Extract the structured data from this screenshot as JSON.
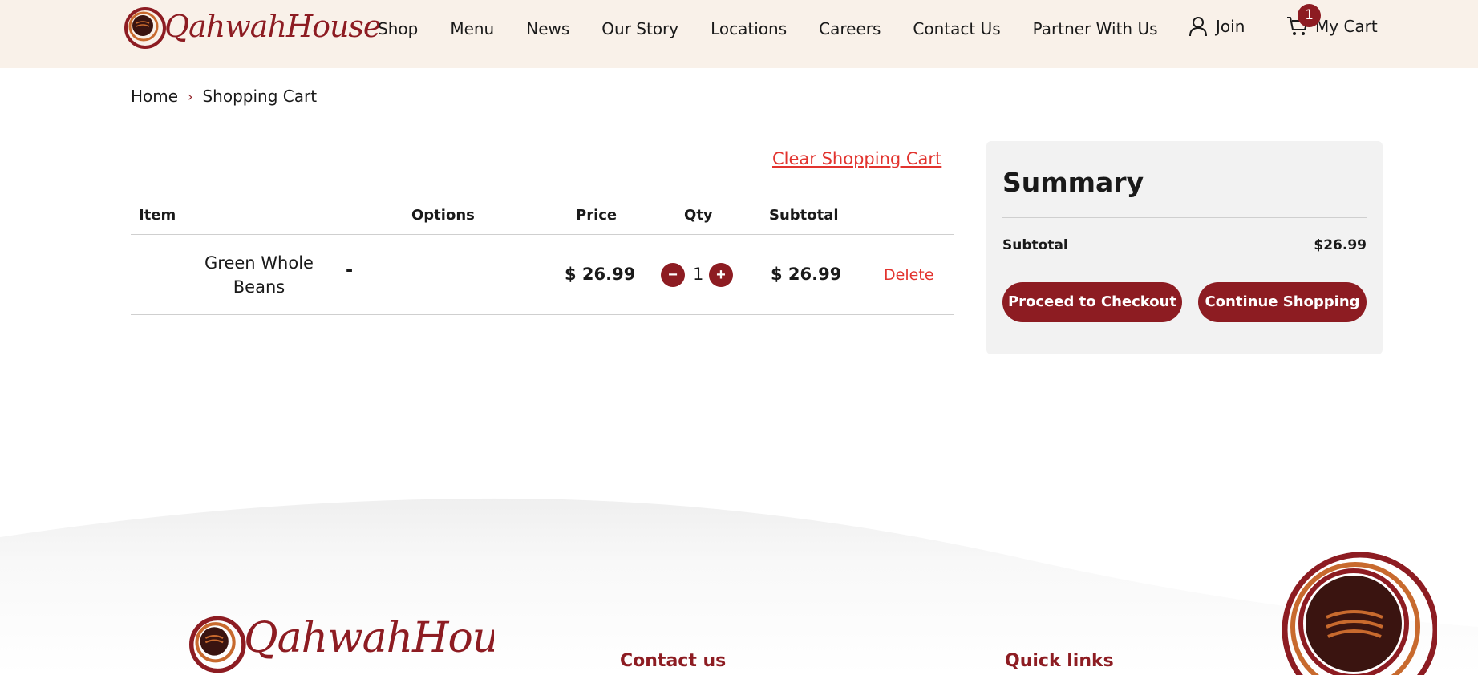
{
  "brand": {
    "name": "QahwahHouse",
    "color": "#8d1c22",
    "accent": "#c86a2e"
  },
  "header": {
    "nav": [
      "Shop",
      "Menu",
      "News",
      "Our Story",
      "Locations",
      "Careers",
      "Contact Us",
      "Partner With Us"
    ],
    "join_label": "Join",
    "join_icon": "user-icon",
    "cart_label": "My Cart",
    "cart_icon": "cart-icon",
    "cart_count": "1"
  },
  "breadcrumb": {
    "home": "Home",
    "separator": "›",
    "current": "Shopping Cart"
  },
  "cart": {
    "clear_label": "Clear Shopping Cart",
    "columns": {
      "item": "Item",
      "options": "Options",
      "price": "Price",
      "qty": "Qty",
      "subtotal": "Subtotal"
    },
    "rows": [
      {
        "item": "Green Whole Beans",
        "options": "-",
        "price": "$ 26.99",
        "qty": "1",
        "subtotal": "$ 26.99",
        "delete_label": "Delete",
        "minus": "−",
        "plus": "+"
      }
    ]
  },
  "summary": {
    "title": "Summary",
    "subtotal_label": "Subtotal",
    "subtotal_value": "$26.99",
    "checkout_label": "Proceed to Checkout",
    "continue_label": "Continue Shopping"
  },
  "footer": {
    "contact_heading": "Contact us",
    "links_heading": "Quick links"
  }
}
